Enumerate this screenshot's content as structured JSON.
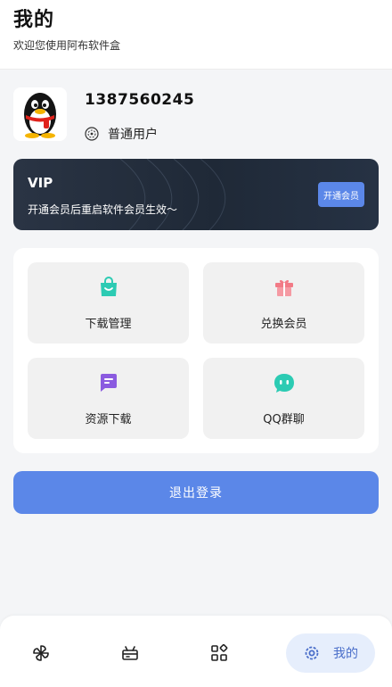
{
  "header": {
    "title": "我的",
    "subtitle": "欢迎您使用阿布软件盒"
  },
  "profile": {
    "username": "1387560245",
    "user_type": "普通用户",
    "avatar_icon": "qq-penguin-avatar"
  },
  "vip": {
    "label": "VIP",
    "description": "开通会员后重启软件会员生效～",
    "button_label": "开通会员"
  },
  "features": [
    {
      "label": "下载管理",
      "icon": "shopping-bag-icon",
      "color": "#2ccbb3"
    },
    {
      "label": "兑换会员",
      "icon": "gift-icon",
      "color": "#f27a86"
    },
    {
      "label": "资源下载",
      "icon": "chat-bubble-icon",
      "color": "#8b5be0"
    },
    {
      "label": "QQ群聊",
      "icon": "qq-chat-icon",
      "color": "#2ccbb3"
    }
  ],
  "logout_label": "退出登录",
  "nav": {
    "items": [
      "pinwheel-icon",
      "gift-box-icon",
      "apps-icon",
      "settings-icon"
    ],
    "active_label": "我的"
  },
  "colors": {
    "accent": "#5b87e8",
    "vip_bg": "#1f2937",
    "nav_active_bg": "#e6eefc"
  }
}
